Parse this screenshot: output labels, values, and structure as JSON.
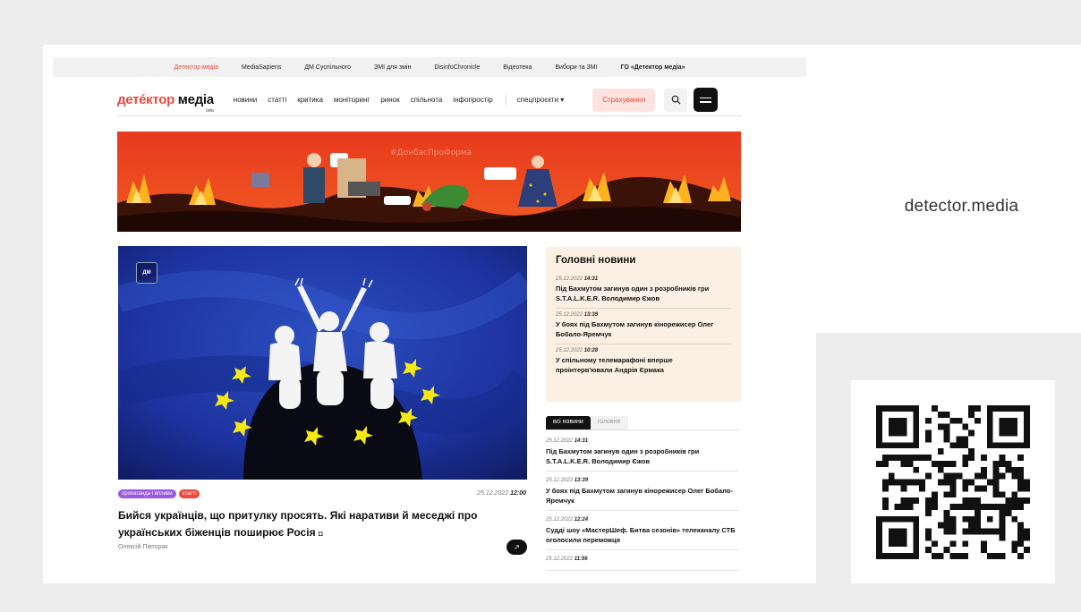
{
  "domain_label": "detector.media",
  "top_links": [
    {
      "label": "Детектор медіа",
      "active": true,
      "bold": false
    },
    {
      "label": "MediaSapiens",
      "active": false,
      "bold": false
    },
    {
      "label": "ДМ Суспільного",
      "active": false,
      "bold": false
    },
    {
      "label": "ЗМІ для змін",
      "active": false,
      "bold": false
    },
    {
      "label": "DisinfoChronicle",
      "active": false,
      "bold": false
    },
    {
      "label": "Відеотека",
      "active": false,
      "bold": false
    },
    {
      "label": "Вибори та ЗМІ",
      "active": false,
      "bold": false
    },
    {
      "label": "ГО «Детектор медіа»",
      "active": false,
      "bold": true
    }
  ],
  "logo": {
    "part1": "детéктор",
    "part2": " медіа",
    "beta": "beta"
  },
  "nav": [
    "новини",
    "статті",
    "критика",
    "моніторинг",
    "ринок",
    "спільнота",
    "інфопростір"
  ],
  "special": "спецпроєкти ▾",
  "insure_label": "Страхування",
  "featured": {
    "badge": "ДМ",
    "tags": [
      "пропаганда і впливи",
      "статті"
    ],
    "date": "25.12.2022",
    "time": "12:00",
    "title": "Бийся українців, що притулку просять. Які наративи й меседжі про українських біженців поширює Росія",
    "author": "Олексій Півторак",
    "arrow": "↗"
  },
  "main_news": {
    "heading": "Головні новини",
    "items": [
      {
        "date": "25.12.2022",
        "time": "14:31",
        "title": "Під Бахмутом загинув один з розробників гри S.T.A.L.K.E.R. Володимир Єжов"
      },
      {
        "date": "25.12.2022",
        "time": "13:39",
        "title": "У боях під Бахмутом загинув кінорежисер Олег Бобало-Яремчук"
      },
      {
        "date": "25.12.2022",
        "time": "10:28",
        "title": "У спільному телемарафоні вперше проінтерв'ювали Андрія Єрмака"
      }
    ]
  },
  "tabs": [
    "всі новини",
    "головне"
  ],
  "news_list": [
    {
      "date": "25.12.2022",
      "time": "14:31",
      "title": "Під Бахмутом загинув один з розробників гри S.T.A.L.K.E.R. Володимир Єжов"
    },
    {
      "date": "25.12.2022",
      "time": "13:39",
      "title": "У боях під Бахмутом загинув кінорежисер Олег Бобало-Яремчук"
    },
    {
      "date": "25.12.2022",
      "time": "12:24",
      "title": "Судді шоу «МастерШеф. Битва сезонів» телеканалу СТБ оголосили переможця"
    },
    {
      "date": "25.12.2022",
      "time": "11:56",
      "title": ""
    }
  ],
  "colors": {
    "accent": "#e84a3c",
    "bg": "#ededed",
    "main_news_bg": "#fcefe3"
  }
}
